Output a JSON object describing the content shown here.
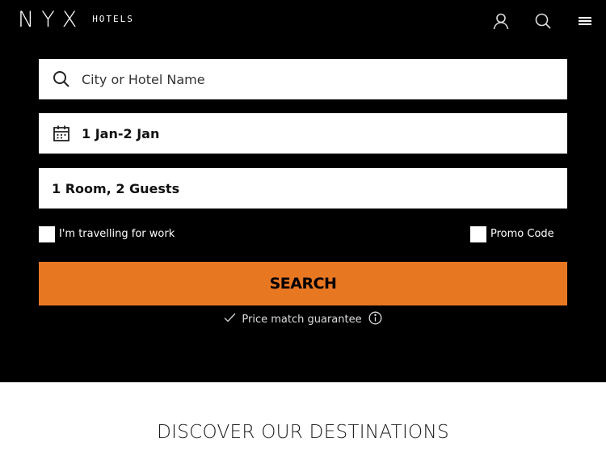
{
  "header": {
    "logo_mark": "NYX",
    "logo_sub": "HOTELS",
    "icons": [
      "user-icon",
      "search-icon",
      "menu-icon"
    ]
  },
  "booking": {
    "search": {
      "placeholder": "City or Hotel Name",
      "value": "",
      "icon": "search-icon"
    },
    "dates": {
      "value": "1 Jan-2 Jan",
      "icon": "calendar-icon"
    },
    "guests": {
      "value": "1 Room, 2 Guests"
    },
    "work_label": "I'm travelling for work",
    "promo_label": "Promo Code",
    "search_button": "SEARCH",
    "price_match": "Price match guarantee"
  },
  "sections": {
    "destinations_title": "DISCOVER OUR DESTINATIONS"
  },
  "colors": {
    "hero_bg": "#000000",
    "accent": "#e87722",
    "field_bg": "#ffffff"
  }
}
